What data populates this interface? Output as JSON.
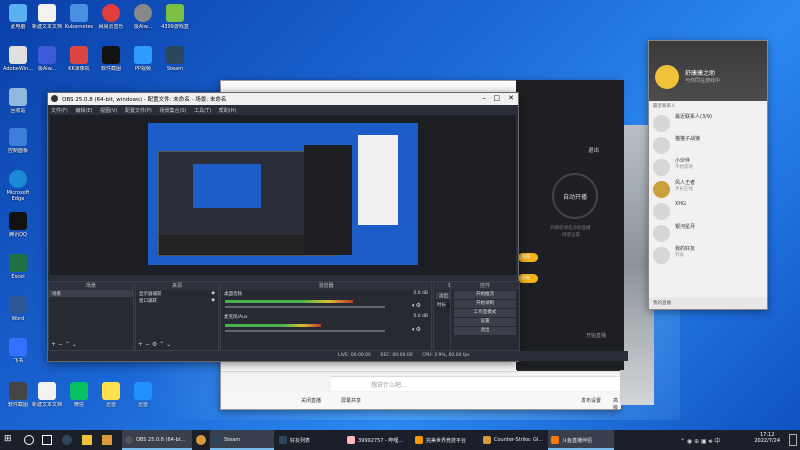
{
  "desktop_icons": [
    {
      "label": "此电脑",
      "color": "#5ab0f0"
    },
    {
      "label": "AdobeWin...",
      "color": "#e0e0e0"
    },
    {
      "label": "Kubernetes",
      "color": "#4a90e2"
    },
    {
      "label": "网易云音乐",
      "color": "#e23c3c"
    },
    {
      "label": "极Aiw...",
      "color": "#3b5bdb"
    },
    {
      "label": "4399游戏盒",
      "color": "#7bc043"
    },
    {
      "label": "回收站",
      "color": "#8fb8de"
    },
    {
      "label": "新建文本文档",
      "color": "#f2f2f2"
    },
    {
      "label": "KK录像机",
      "color": "#d44"
    },
    {
      "label": "软件截图",
      "color": "#444"
    },
    {
      "label": "PP视频",
      "color": "#2e9bff"
    },
    {
      "label": "Steam",
      "color": "#2a475e"
    },
    {
      "label": "控制面板",
      "color": "#3d7fd6"
    },
    {
      "label": "Microsoft Edge",
      "color": "#1a8ad4"
    },
    {
      "label": "腾讯QQ",
      "color": "#111"
    },
    {
      "label": "Excel",
      "color": "#1f7244"
    },
    {
      "label": "Word",
      "color": "#2b5797"
    },
    {
      "label": "飞书",
      "color": "#3370ff"
    },
    {
      "label": "微信",
      "color": "#07c160"
    },
    {
      "label": "迅雷",
      "color": "#1e90ff"
    }
  ],
  "chat": {
    "input_placeholder": "想说什么吧...",
    "status_left": "关闭直播",
    "status_mid": "屏幕共享",
    "status_r1": "发布设置",
    "status_r2": "高级"
  },
  "center_panel": {
    "auto_label": "自动开播",
    "exit_label": "退出",
    "hint_line1": "开播前请先添加直播",
    "hint_line2": "场景设置",
    "pill_1": "推荐",
    "pill_2": "开始",
    "start_button": "开始直播"
  },
  "right_panel": {
    "name": "舒康康之助",
    "sign": "与你同在游戏中",
    "section": "最近联系人",
    "contacts": [
      {
        "name": "最近联系人(3/9)",
        "sub": ""
      },
      {
        "name": "猫猫子战狼",
        "sub": ""
      },
      {
        "name": "小伙伴",
        "sub": "不想说明"
      },
      {
        "name": "风人王者",
        "sub": "手机在线"
      },
      {
        "name": "XHG",
        "sub": ""
      },
      {
        "name": "银河星月",
        "sub": ""
      },
      {
        "name": "我的好友",
        "sub": "列表"
      }
    ],
    "footer": "我的直播"
  },
  "obs": {
    "title": "OBS 25.0.8 (64-bit, windows) - 配置文件: 未命名 - 场景: 未命名",
    "menu": [
      "文件(F)",
      "编辑(E)",
      "视图(V)",
      "配置文件(P)",
      "场景集合(S)",
      "工具(T)",
      "帮助(H)"
    ],
    "docks": {
      "scenes": "场景",
      "sources": "来源",
      "mixer": "混音器",
      "transitions": "转场特效",
      "controls": "控件"
    },
    "scene_item": "场景",
    "source_items": [
      "显示器捕获",
      "窗口捕获"
    ],
    "mixer_tracks": [
      {
        "name": "桌面音频",
        "value": "0.0 dB",
        "level": 0.8
      },
      {
        "name": "麦克风/Aux",
        "value": "0.0 dB",
        "level": 0.6
      }
    ],
    "transition_type": "淡出",
    "duration_label": "时长",
    "duration_value": "300 ms",
    "controls": [
      "开始推流",
      "开始录制",
      "工作室模式",
      "设置",
      "退出"
    ],
    "status": [
      "LIVE: 00:00:00",
      "REC: 00:00:00",
      "CPU: 3.9%, 60.00 fps"
    ]
  },
  "taskbar": {
    "items": [
      {
        "label": "OBS 25.0.8 (64-bi...",
        "color": "#555"
      },
      {
        "label": "Steam",
        "color": "#2a475e"
      },
      {
        "label": "好友列表",
        "color": "#2a475e"
      },
      {
        "label": "39992757 - 哔哩...",
        "color": "#fbb"
      },
      {
        "label": "完美世界竞技平台",
        "color": "#f90"
      },
      {
        "label": "Counter-Strike: Gl...",
        "color": "#d79b3a"
      },
      {
        "label": "斗鱼直播伴侣",
        "color": "#ff7a00"
      }
    ],
    "time": "17:12",
    "date": "2022/7/24"
  }
}
